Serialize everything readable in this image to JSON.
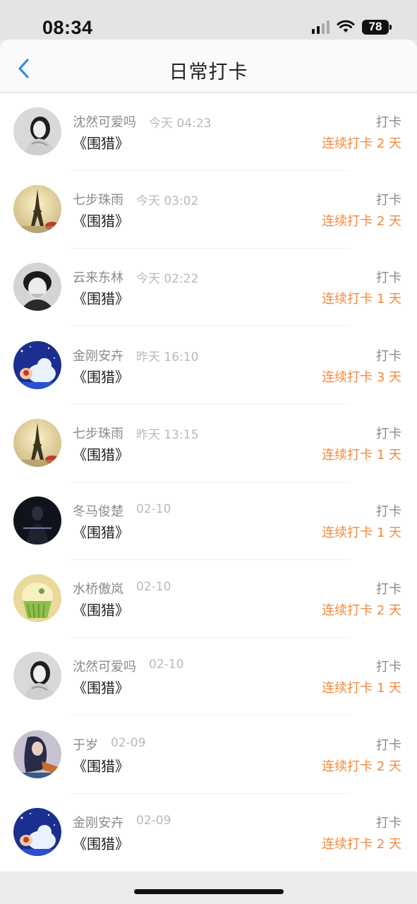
{
  "status_bar": {
    "time": "08:34",
    "battery": "78"
  },
  "nav": {
    "title": "日常打卡"
  },
  "colors": {
    "accent_blue": "#3a8fd6",
    "streak_orange": "#f08a3e"
  },
  "items": [
    {
      "name": "沈然可爱吗",
      "time": "今天 04:23",
      "book": "《围猎》",
      "action": "打卡",
      "streak": "连续打卡 2 天",
      "avatar": "portrait-woman-gray"
    },
    {
      "name": "七步珠雨",
      "time": "今天 03:02",
      "book": "《围猎》",
      "action": "打卡",
      "streak": "连续打卡 2 天",
      "avatar": "eiffel-tower"
    },
    {
      "name": "云来东林",
      "time": "今天 02:22",
      "book": "《围猎》",
      "action": "打卡",
      "streak": "连续打卡 1 天",
      "avatar": "portrait-laughing-gray"
    },
    {
      "name": "金刚安卉",
      "time": "昨天 16:10",
      "book": "《围猎》",
      "action": "打卡",
      "streak": "连续打卡 3 天",
      "avatar": "cartoon-night-sky"
    },
    {
      "name": "七步珠雨",
      "time": "昨天 13:15",
      "book": "《围猎》",
      "action": "打卡",
      "streak": "连续打卡 1 天",
      "avatar": "eiffel-tower"
    },
    {
      "name": "冬马俊楚",
      "time": "02-10",
      "book": "《围猎》",
      "action": "打卡",
      "streak": "连续打卡 1 天",
      "avatar": "dark-silhouette"
    },
    {
      "name": "水桥傲岚",
      "time": "02-10",
      "book": "《围猎》",
      "action": "打卡",
      "streak": "连续打卡 2 天",
      "avatar": "cupcake"
    },
    {
      "name": "沈然可爱吗",
      "time": "02-10",
      "book": "《围猎》",
      "action": "打卡",
      "streak": "连续打卡 1 天",
      "avatar": "portrait-woman-gray"
    },
    {
      "name": "于岁",
      "time": "02-09",
      "book": "《围猎》",
      "action": "打卡",
      "streak": "连续打卡 2 天",
      "avatar": "painting-woman"
    },
    {
      "name": "金刚安卉",
      "time": "02-09",
      "book": "《围猎》",
      "action": "打卡",
      "streak": "连续打卡 2 天",
      "avatar": "cartoon-night-sky"
    }
  ]
}
